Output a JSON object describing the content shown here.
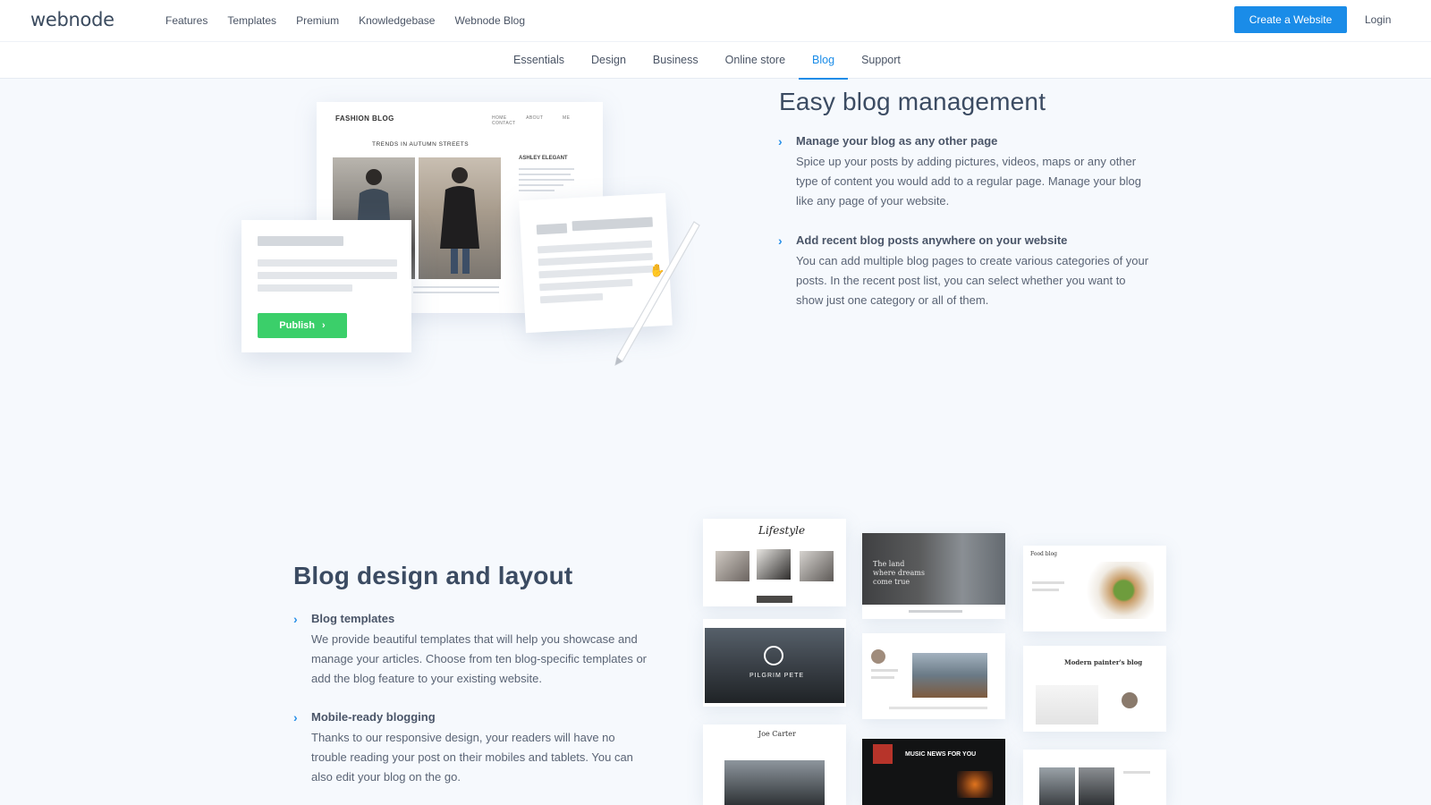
{
  "brand": {
    "logo": "webnode"
  },
  "nav": {
    "items": [
      "Features",
      "Templates",
      "Premium",
      "Knowledgebase",
      "Webnode Blog"
    ]
  },
  "header": {
    "cta": "Create a Website",
    "login": "Login"
  },
  "subnav": {
    "items": [
      "Essentials",
      "Design",
      "Business",
      "Online store",
      "Blog",
      "Support"
    ],
    "active": "Blog"
  },
  "section1": {
    "title": "Easy blog management",
    "features": [
      {
        "title": "Manage your blog as any other page",
        "text": "Spice up your posts by adding pictures, videos, maps or any other type of content you would add to a regular page. Manage your blog like any page of your website."
      },
      {
        "title": "Add recent blog posts anywhere on your website",
        "text": "You can add multiple blog pages to create various categories of your posts. In the recent post list, you can select whether you want to show just one category or all of them."
      }
    ],
    "illustration": {
      "blog_title": "FASHION BLOG",
      "blog_nav": "HOME ABOUT ME CONTACT",
      "post_heading": "TRENDS IN AUTUMN STREETS",
      "side_title": "ASHLEY ELEGANT",
      "publish_label": "Publish"
    }
  },
  "section2": {
    "title": "Blog design and layout",
    "features": [
      {
        "title": "Blog templates",
        "text": "We provide beautiful templates that will help you showcase and manage your articles. Choose from ten blog-specific templates or add the blog feature to your existing website."
      },
      {
        "title": "Mobile-ready blogging",
        "text": "Thanks to our responsive design, your readers will have no trouble reading your post on their mobiles and tablets. You can also edit your blog on the go."
      }
    ],
    "templates": [
      "Lifestyle",
      "The land where dreams come true",
      "Food blog",
      "PILGRIM PETE",
      "Modern painter's blog",
      "Joe Carter",
      "MUSIC NEWS FOR YOU"
    ]
  },
  "colors": {
    "accent": "#1a8ce8",
    "publish": "#3bcf6a",
    "heading": "#3b4b62",
    "background": "#f6f9fd"
  }
}
